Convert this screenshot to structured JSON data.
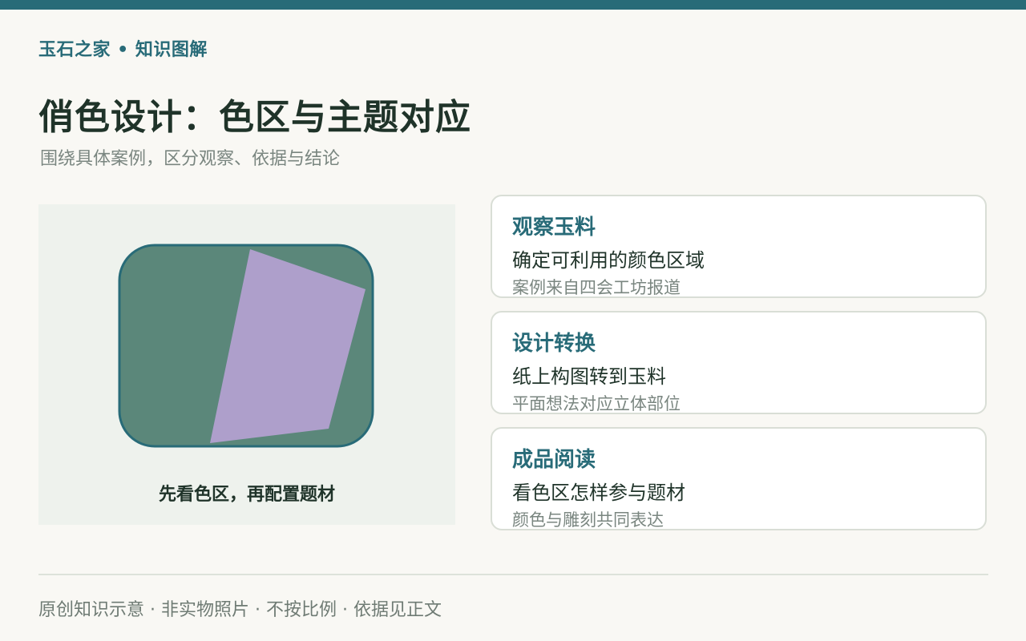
{
  "brand": "玉石之家 • 知识图解",
  "title": "俏色设计：色区与主题对应",
  "subtitle": "围绕具体案例，区分观察、依据与结论",
  "illustration": {
    "caption": "先看色区，再配置题材",
    "colors": {
      "panel": "#eef2ed",
      "stone": "#5b877a",
      "stone_border": "#286b78",
      "color_zone": "#ae9fcb"
    }
  },
  "cards": [
    {
      "title": "观察玉料",
      "body": "确定可利用的颜色区域",
      "note": "案例来自四会工坊报道"
    },
    {
      "title": "设计转换",
      "body": "纸上构图转到玉料",
      "note": "平面想法对应立体部位"
    },
    {
      "title": "成品阅读",
      "body": "看色区怎样参与题材",
      "note": "颜色与雕刻共同表达"
    }
  ],
  "footer": "原创知识示意 · 非实物照片 · 不按比例 · 依据见正文",
  "colors": {
    "accent": "#286b78",
    "text": "#1f3329",
    "muted": "#7a8680",
    "background": "#f9f8f4"
  }
}
